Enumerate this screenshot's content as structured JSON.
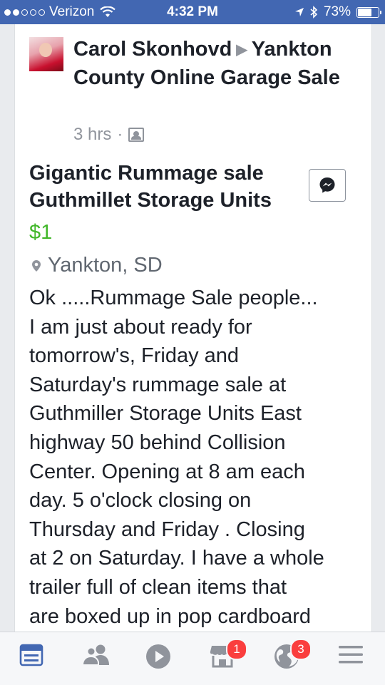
{
  "status_bar": {
    "carrier": "Verizon",
    "time": "4:32 PM",
    "battery_percent": "73%",
    "battery_level": 0.73,
    "signal_bars_filled": 2,
    "signal_bars_total": 5
  },
  "post": {
    "author": "Carol Skonhovd",
    "group": "Yankton County Online Garage Sale",
    "time_ago": "3 hrs",
    "separator": "·",
    "title": "Gigantic Rummage sale Guthmillet Storage Units",
    "price": "$1",
    "location": "Yankton, SD",
    "body": "Ok .....Rummage Sale  people...\nI am just about ready for\ntomorrow's,  Friday and\nSaturday's rummage sale at\nGuthmiller Storage Units East\nhighway 50 behind Collision\nCenter.  Opening at 8 am each\nday. 5 o'clock closing on\nThursday and Friday .  Closing\nat 2 on Saturday. I have a whole\ntrailer full of clean items that\nare  boxed up in pop cardboard"
  },
  "tab_bar": {
    "active_color": "#4267b2",
    "inactive_color": "#90949c",
    "tabs": [
      {
        "icon": "news-feed-icon",
        "active": true
      },
      {
        "icon": "friends-icon"
      },
      {
        "icon": "video-play-icon"
      },
      {
        "icon": "marketplace-icon",
        "badge": "1"
      },
      {
        "icon": "globe-notifications-icon",
        "badge": "3"
      },
      {
        "icon": "menu-icon"
      }
    ]
  }
}
